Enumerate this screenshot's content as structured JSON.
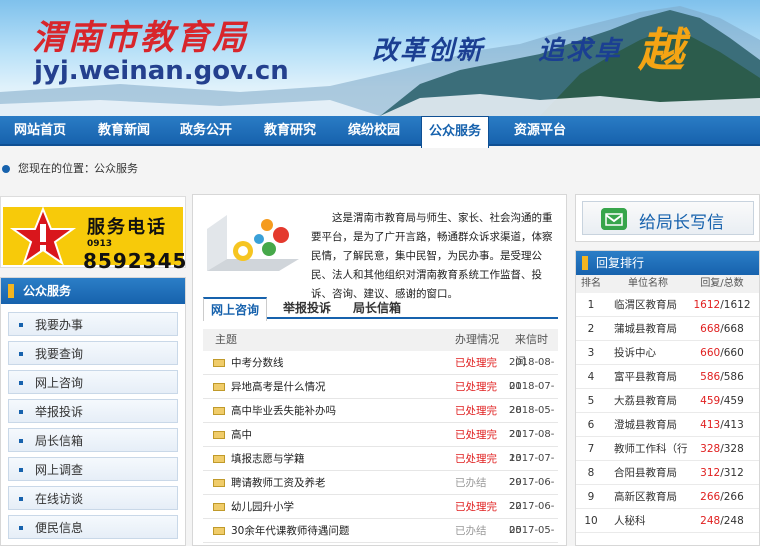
{
  "header": {
    "site_name": "渭南市教育局",
    "domain": "jyj.weinan.gov.cn",
    "slogan_1": "改革创新",
    "slogan_2": "追求卓",
    "slogan_3": "越"
  },
  "nav": {
    "items": [
      {
        "label": "网站首页"
      },
      {
        "label": "教育新闻"
      },
      {
        "label": "政务公开"
      },
      {
        "label": "教育研究"
      },
      {
        "label": "缤纷校园"
      },
      {
        "label": "公众服务",
        "active": true
      },
      {
        "label": "资源平台"
      }
    ]
  },
  "breadcrumb": {
    "prefix": "您现在的位置：",
    "separator": "›",
    "current": "公众服务"
  },
  "hotline": {
    "title": "服务电话",
    "area_code": "0913",
    "number": "8592345"
  },
  "left_panel": {
    "title": "公众服务",
    "items": [
      "我要办事",
      "我要查询",
      "网上咨询",
      "举报投诉",
      "局长信箱",
      "网上调查",
      "在线访谈",
      "便民信息"
    ]
  },
  "center": {
    "intro": "这是渭南市教育局与师生、家长、社会沟通的重要平台，是为了广开言路，畅通群众诉求渠道，体察民情，了解民意，集中民智，为民办事。是受理公民、法人和其他组织对渭南教育系统工作监督、投诉、咨询、建议、感谢的窗口。",
    "tabs": [
      "网上咨询",
      "举报投诉",
      "局长信箱"
    ],
    "table_headers": {
      "subject": "主题",
      "status": "办理情况",
      "date": "来信时间"
    },
    "rows": [
      {
        "subject": "中考分数线",
        "status": "已处理完",
        "date": "2018-08-01",
        "done": true
      },
      {
        "subject": "异地高考是什么情况",
        "status": "已处理完",
        "date": "2018-07-28",
        "done": true
      },
      {
        "subject": "高中毕业丢失能补办吗",
        "status": "已处理完",
        "date": "2018-05-21",
        "done": true
      },
      {
        "subject": "高中",
        "status": "已处理完",
        "date": "2017-08-13",
        "done": true
      },
      {
        "subject": "填报志愿与学籍",
        "status": "已处理完",
        "date": "2017-07-29",
        "done": true
      },
      {
        "subject": "聘请教师工资及养老",
        "status": "已办结",
        "date": "2017-06-22",
        "done": false
      },
      {
        "subject": "幼儿园升小学",
        "status": "已处理完",
        "date": "2017-06-05",
        "done": true
      },
      {
        "subject": "30余年代课教师待遇问题",
        "status": "已办结",
        "date": "2017-05-26",
        "done": false
      }
    ]
  },
  "letter": {
    "label": "给局长写信"
  },
  "ranking": {
    "title": "回复排行",
    "headers": {
      "no": "排名",
      "unit": "单位名称",
      "count": "回复/总数"
    },
    "rows": [
      {
        "no": "1",
        "unit": "临渭区教育局",
        "replied": "1612",
        "total": "/1612"
      },
      {
        "no": "2",
        "unit": "蒲城县教育局",
        "replied": "668",
        "total": "/668"
      },
      {
        "no": "3",
        "unit": "投诉中心",
        "replied": "660",
        "total": "/660"
      },
      {
        "no": "4",
        "unit": "富平县教育局",
        "replied": "586",
        "total": "/586"
      },
      {
        "no": "5",
        "unit": "大荔县教育局",
        "replied": "459",
        "total": "/459"
      },
      {
        "no": "6",
        "unit": "澄城县教育局",
        "replied": "413",
        "total": "/413"
      },
      {
        "no": "7",
        "unit": "教师工作科（行",
        "replied": "328",
        "total": "/328"
      },
      {
        "no": "8",
        "unit": "合阳县教育局",
        "replied": "312",
        "total": "/312"
      },
      {
        "no": "9",
        "unit": "高新区教育局",
        "replied": "266",
        "total": "/266"
      },
      {
        "no": "10",
        "unit": "人秘科",
        "replied": "248",
        "total": "/248"
      }
    ]
  }
}
